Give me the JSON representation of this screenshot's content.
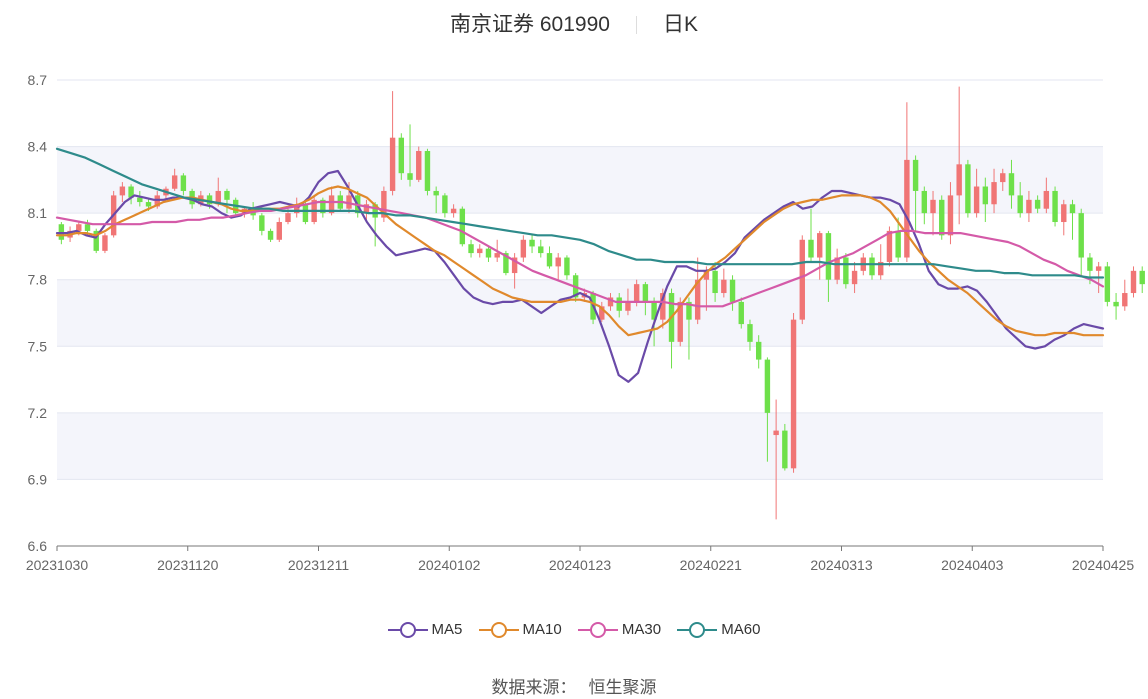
{
  "header": {
    "stock_name": "南京证券 601990",
    "period": "日K"
  },
  "source": {
    "label": "数据来源：",
    "value": "恒生聚源"
  },
  "legend": [
    {
      "name": "MA5",
      "color": "#6a4aa8"
    },
    {
      "name": "MA10",
      "color": "#e0892c"
    },
    {
      "name": "MA30",
      "color": "#d45aa8"
    },
    {
      "name": "MA60",
      "color": "#2e8b8b"
    }
  ],
  "colors": {
    "up": "#f07575",
    "down": "#6ee04a",
    "band": "#f4f5fb",
    "grid": "#e3e6f0",
    "axis": "#777777"
  },
  "chart_data": {
    "type": "candlestick",
    "title": "南京证券 601990 日K",
    "ylim": [
      6.6,
      8.7
    ],
    "yticks": [
      "6.6",
      "6.9",
      "7.2",
      "7.5",
      "7.8",
      "8.1",
      "8.4",
      "8.7"
    ],
    "xtick_labels": [
      "20231030",
      "20231120",
      "20231211",
      "20240102",
      "20240123",
      "20240221",
      "20240313",
      "20240403",
      "20240425"
    ],
    "n_days": 120,
    "candles_ohlc": [
      [
        8.05,
        7.98,
        8.06,
        7.96
      ],
      [
        7.99,
        8.02,
        8.04,
        7.97
      ],
      [
        8.02,
        8.05,
        8.06,
        8.0
      ],
      [
        8.05,
        8.02,
        8.07,
        8.0
      ],
      [
        8.02,
        7.93,
        8.03,
        7.92
      ],
      [
        7.93,
        8.0,
        8.01,
        7.92
      ],
      [
        8.0,
        8.18,
        8.2,
        7.99
      ],
      [
        8.18,
        8.22,
        8.24,
        8.15
      ],
      [
        8.22,
        8.17,
        8.23,
        8.14
      ],
      [
        8.17,
        8.15,
        8.2,
        8.13
      ],
      [
        8.15,
        8.13,
        8.17,
        8.11
      ],
      [
        8.13,
        8.18,
        8.2,
        8.12
      ],
      [
        8.18,
        8.21,
        8.22,
        8.16
      ],
      [
        8.21,
        8.27,
        8.3,
        8.2
      ],
      [
        8.27,
        8.2,
        8.28,
        8.18
      ],
      [
        8.2,
        8.14,
        8.21,
        8.12
      ],
      [
        8.14,
        8.18,
        8.2,
        8.13
      ],
      [
        8.18,
        8.14,
        8.19,
        8.12
      ],
      [
        8.14,
        8.2,
        8.26,
        8.13
      ],
      [
        8.2,
        8.16,
        8.21,
        8.1
      ],
      [
        8.16,
        8.1,
        8.17,
        8.09
      ],
      [
        8.1,
        8.12,
        8.13,
        8.08
      ],
      [
        8.12,
        8.09,
        8.15,
        8.07
      ],
      [
        8.09,
        8.02,
        8.1,
        8.0
      ],
      [
        8.02,
        7.98,
        8.03,
        7.97
      ],
      [
        7.98,
        8.06,
        8.08,
        7.97
      ],
      [
        8.06,
        8.1,
        8.12,
        8.05
      ],
      [
        8.1,
        8.14,
        8.17,
        8.08
      ],
      [
        8.14,
        8.06,
        8.15,
        8.05
      ],
      [
        8.06,
        8.16,
        8.18,
        8.05
      ],
      [
        8.16,
        8.1,
        8.17,
        8.08
      ],
      [
        8.1,
        8.18,
        8.22,
        8.09
      ],
      [
        8.18,
        8.12,
        8.2,
        8.11
      ],
      [
        8.12,
        8.18,
        8.24,
        8.1
      ],
      [
        8.18,
        8.1,
        8.2,
        8.08
      ],
      [
        8.1,
        8.14,
        8.16,
        8.06
      ],
      [
        8.14,
        8.08,
        8.15,
        7.95
      ],
      [
        8.08,
        8.2,
        8.22,
        8.06
      ],
      [
        8.2,
        8.44,
        8.65,
        8.18
      ],
      [
        8.44,
        8.28,
        8.46,
        8.25
      ],
      [
        8.28,
        8.25,
        8.5,
        8.22
      ],
      [
        8.25,
        8.38,
        8.4,
        8.24
      ],
      [
        8.38,
        8.2,
        8.39,
        8.18
      ],
      [
        8.2,
        8.18,
        8.22,
        8.1
      ],
      [
        8.18,
        8.1,
        8.19,
        8.08
      ],
      [
        8.1,
        8.12,
        8.14,
        8.08
      ],
      [
        8.12,
        7.96,
        8.13,
        7.95
      ],
      [
        7.96,
        7.92,
        7.98,
        7.9
      ],
      [
        7.92,
        7.94,
        7.96,
        7.9
      ],
      [
        7.94,
        7.9,
        7.95,
        7.88
      ],
      [
        7.9,
        7.92,
        7.98,
        7.88
      ],
      [
        7.92,
        7.83,
        7.93,
        7.82
      ],
      [
        7.83,
        7.9,
        7.92,
        7.76
      ],
      [
        7.9,
        7.98,
        8.0,
        7.88
      ],
      [
        7.98,
        7.95,
        8.0,
        7.92
      ],
      [
        7.95,
        7.92,
        7.98,
        7.9
      ],
      [
        7.92,
        7.86,
        7.95,
        7.85
      ],
      [
        7.86,
        7.9,
        7.92,
        7.8
      ],
      [
        7.9,
        7.82,
        7.91,
        7.8
      ],
      [
        7.82,
        7.72,
        7.83,
        7.7
      ],
      [
        7.72,
        7.74,
        7.76,
        7.7
      ],
      [
        7.74,
        7.62,
        7.75,
        7.6
      ],
      [
        7.62,
        7.68,
        7.7,
        7.61
      ],
      [
        7.68,
        7.72,
        7.74,
        7.66
      ],
      [
        7.72,
        7.66,
        7.74,
        7.63
      ],
      [
        7.66,
        7.7,
        7.76,
        7.64
      ],
      [
        7.7,
        7.78,
        7.8,
        7.68
      ],
      [
        7.78,
        7.7,
        7.79,
        7.64
      ],
      [
        7.7,
        7.62,
        7.72,
        7.5
      ],
      [
        7.62,
        7.74,
        7.76,
        7.58
      ],
      [
        7.74,
        7.52,
        7.76,
        7.4
      ],
      [
        7.52,
        7.7,
        7.72,
        7.5
      ],
      [
        7.7,
        7.62,
        7.72,
        7.44
      ],
      [
        7.62,
        7.8,
        7.9,
        7.6
      ],
      [
        7.8,
        7.84,
        7.86,
        7.66
      ],
      [
        7.84,
        7.74,
        7.88,
        7.7
      ],
      [
        7.74,
        7.8,
        7.85,
        7.72
      ],
      [
        7.8,
        7.7,
        7.82,
        7.66
      ],
      [
        7.7,
        7.6,
        7.72,
        7.58
      ],
      [
        7.6,
        7.52,
        7.62,
        7.48
      ],
      [
        7.52,
        7.44,
        7.55,
        7.4
      ],
      [
        7.44,
        7.2,
        7.45,
        6.98
      ],
      [
        7.1,
        7.12,
        7.26,
        6.72
      ],
      [
        7.12,
        6.95,
        7.15,
        6.94
      ],
      [
        6.95,
        7.62,
        7.65,
        6.93
      ],
      [
        7.62,
        7.98,
        8.0,
        7.6
      ],
      [
        7.98,
        7.9,
        8.12,
        7.88
      ],
      [
        7.9,
        8.01,
        8.02,
        7.8
      ],
      [
        8.01,
        7.8,
        8.02,
        7.7
      ],
      [
        7.8,
        7.9,
        7.94,
        7.78
      ],
      [
        7.9,
        7.78,
        7.92,
        7.76
      ],
      [
        7.78,
        7.84,
        7.88,
        7.74
      ],
      [
        7.84,
        7.9,
        7.92,
        7.82
      ],
      [
        7.9,
        7.82,
        7.92,
        7.8
      ],
      [
        7.82,
        7.88,
        7.96,
        7.8
      ],
      [
        7.88,
        8.02,
        8.04,
        7.86
      ],
      [
        8.02,
        7.9,
        8.08,
        7.88
      ],
      [
        7.9,
        8.34,
        8.6,
        7.88
      ],
      [
        8.34,
        8.2,
        8.36,
        8.02
      ],
      [
        8.2,
        8.1,
        8.22,
        8.05
      ],
      [
        8.1,
        8.16,
        8.2,
        8.0
      ],
      [
        8.16,
        8.0,
        8.18,
        7.98
      ],
      [
        8.0,
        8.18,
        8.24,
        7.96
      ],
      [
        8.18,
        8.32,
        8.67,
        8.05
      ],
      [
        8.32,
        8.1,
        8.34,
        8.08
      ],
      [
        8.1,
        8.22,
        8.3,
        8.08
      ],
      [
        8.22,
        8.14,
        8.26,
        8.06
      ],
      [
        8.14,
        8.24,
        8.3,
        8.1
      ],
      [
        8.24,
        8.28,
        8.3,
        8.2
      ],
      [
        8.28,
        8.18,
        8.34,
        8.12
      ],
      [
        8.18,
        8.1,
        8.24,
        8.08
      ],
      [
        8.1,
        8.16,
        8.2,
        8.06
      ],
      [
        8.16,
        8.12,
        8.18,
        8.1
      ],
      [
        8.12,
        8.2,
        8.26,
        8.1
      ],
      [
        8.2,
        8.06,
        8.22,
        8.04
      ],
      [
        8.06,
        8.14,
        8.16,
        8.0
      ],
      [
        8.14,
        8.1,
        8.16,
        7.98
      ],
      [
        8.1,
        7.9,
        8.12,
        7.82
      ],
      [
        7.9,
        7.84,
        7.92,
        7.78
      ],
      [
        7.84,
        7.86,
        7.88,
        7.74
      ],
      [
        7.86,
        7.7,
        7.88,
        7.68
      ],
      [
        7.7,
        7.68,
        7.74,
        7.62
      ],
      [
        7.68,
        7.74,
        7.8,
        7.66
      ],
      [
        7.74,
        7.84,
        7.86,
        7.72
      ],
      [
        7.84,
        7.78,
        7.86,
        7.74
      ],
      [
        7.78,
        7.82,
        7.84,
        7.72
      ],
      [
        7.82,
        7.72,
        7.84,
        7.7
      ],
      [
        7.72,
        7.66,
        7.74,
        7.64
      ],
      [
        7.66,
        7.62,
        7.68,
        7.6
      ],
      [
        7.62,
        7.52,
        7.64,
        7.5
      ],
      [
        7.52,
        7.58,
        7.6,
        7.5
      ],
      [
        7.58,
        7.46,
        7.6,
        7.42
      ],
      [
        7.46,
        7.56,
        7.58,
        7.4
      ],
      [
        7.56,
        7.44,
        7.58,
        7.36
      ],
      [
        7.44,
        7.38,
        7.48,
        7.33
      ],
      [
        7.38,
        7.58,
        7.6,
        7.36
      ],
      [
        7.58,
        7.64,
        7.66,
        7.56
      ],
      [
        7.64,
        7.56,
        7.66,
        7.54
      ],
      [
        7.56,
        7.6,
        7.64,
        7.52
      ],
      [
        7.6,
        7.58,
        7.62,
        7.55
      ],
      [
        7.58,
        7.64,
        7.66,
        7.56
      ],
      [
        7.64,
        7.56,
        7.66,
        7.54
      ],
      [
        7.56,
        7.62,
        7.65,
        7.55
      ],
      [
        7.62,
        7.58,
        7.64,
        7.57
      ],
      [
        7.58,
        7.6,
        7.66,
        7.56
      ]
    ],
    "series": [
      {
        "name": "MA5",
        "values": [
          8.01,
          8.01,
          8.02,
          8.0,
          7.99,
          8.05,
          8.1,
          8.15,
          8.18,
          8.17,
          8.16,
          8.16,
          8.17,
          8.17,
          8.16,
          8.14,
          8.13,
          8.1,
          8.08,
          8.09,
          8.12,
          8.13,
          8.14,
          8.15,
          8.14,
          8.13,
          8.17,
          8.24,
          8.28,
          8.29,
          8.22,
          8.14,
          8.06,
          8.0,
          7.95,
          7.91,
          7.92,
          7.93,
          7.94,
          7.93,
          7.88,
          7.82,
          7.76,
          7.72,
          7.7,
          7.69,
          7.7,
          7.7,
          7.71,
          7.68,
          7.65,
          7.68,
          7.71,
          7.72,
          7.74,
          7.72,
          7.62,
          7.5,
          7.37,
          7.34,
          7.38,
          7.52,
          7.65,
          7.77,
          7.86,
          7.86,
          7.84,
          7.84,
          7.85,
          7.88,
          7.92,
          7.99,
          8.03,
          8.07,
          8.1,
          8.13,
          8.15,
          8.12,
          8.13,
          8.17,
          8.2,
          8.2,
          8.19,
          8.18,
          8.17,
          8.17,
          8.16,
          8.14,
          8.06,
          7.96,
          7.84,
          7.78,
          7.76,
          7.76,
          7.77,
          7.75,
          7.7,
          7.64,
          7.58,
          7.54,
          7.5,
          7.49,
          7.5,
          7.53,
          7.55,
          7.58,
          7.6,
          7.59,
          7.58
        ]
      },
      {
        "name": "MA10",
        "values": [
          8.0,
          8.0,
          8.01,
          8.01,
          8.0,
          8.02,
          8.05,
          8.07,
          8.09,
          8.11,
          8.13,
          8.15,
          8.16,
          8.17,
          8.17,
          8.16,
          8.15,
          8.14,
          8.12,
          8.11,
          8.11,
          8.12,
          8.12,
          8.12,
          8.13,
          8.14,
          8.16,
          8.19,
          8.21,
          8.22,
          8.21,
          8.19,
          8.17,
          8.13,
          8.09,
          8.05,
          8.02,
          7.99,
          7.96,
          7.93,
          7.91,
          7.88,
          7.85,
          7.82,
          7.79,
          7.76,
          7.74,
          7.72,
          7.71,
          7.7,
          7.7,
          7.7,
          7.7,
          7.71,
          7.71,
          7.7,
          7.68,
          7.64,
          7.59,
          7.55,
          7.56,
          7.57,
          7.58,
          7.61,
          7.66,
          7.72,
          7.78,
          7.83,
          7.87,
          7.9,
          7.94,
          7.98,
          8.02,
          8.06,
          8.09,
          8.12,
          8.14,
          8.15,
          8.16,
          8.16,
          8.17,
          8.18,
          8.18,
          8.18,
          8.17,
          8.15,
          8.11,
          8.05,
          7.99,
          7.93,
          7.88,
          7.84,
          7.8,
          7.77,
          7.74,
          7.7,
          7.66,
          7.62,
          7.59,
          7.57,
          7.56,
          7.55,
          7.55,
          7.56,
          7.56,
          7.56,
          7.55,
          7.55,
          7.55
        ]
      },
      {
        "name": "MA30",
        "values": [
          8.08,
          8.07,
          8.06,
          8.05,
          8.05,
          8.05,
          8.05,
          8.05,
          8.06,
          8.06,
          8.06,
          8.07,
          8.07,
          8.08,
          8.08,
          8.09,
          8.1,
          8.11,
          8.11,
          8.12,
          8.13,
          8.14,
          8.15,
          8.15,
          8.15,
          8.14,
          8.13,
          8.12,
          8.11,
          8.1,
          8.09,
          8.08,
          8.06,
          8.04,
          8.02,
          7.99,
          7.96,
          7.93,
          7.9,
          7.87,
          7.84,
          7.82,
          7.8,
          7.78,
          7.76,
          7.74,
          7.72,
          7.7,
          7.7,
          7.7,
          7.7,
          7.7,
          7.69,
          7.69,
          7.68,
          7.68,
          7.68,
          7.7,
          7.72,
          7.74,
          7.76,
          7.78,
          7.8,
          7.82,
          7.85,
          7.88,
          7.9,
          7.92,
          7.95,
          7.98,
          8.01,
          8.02,
          8.02,
          8.01,
          8.01,
          8.01,
          8.01,
          8.0,
          7.99,
          7.98,
          7.97,
          7.95,
          7.92,
          7.89,
          7.87,
          7.84,
          7.82,
          7.8,
          7.77
        ]
      },
      {
        "name": "MA60",
        "values": [
          8.39,
          8.37,
          8.35,
          8.32,
          8.29,
          8.26,
          8.23,
          8.21,
          8.19,
          8.17,
          8.16,
          8.15,
          8.14,
          8.13,
          8.12,
          8.12,
          8.11,
          8.11,
          8.11,
          8.11,
          8.11,
          8.11,
          8.1,
          8.1,
          8.09,
          8.09,
          8.08,
          8.07,
          8.06,
          8.05,
          8.04,
          8.03,
          8.02,
          8.01,
          8.0,
          8.0,
          7.99,
          7.98,
          7.96,
          7.93,
          7.91,
          7.89,
          7.89,
          7.88,
          7.88,
          7.88,
          7.87,
          7.87,
          7.87,
          7.87,
          7.87,
          7.87,
          7.87,
          7.88,
          7.88,
          7.87,
          7.87,
          7.87,
          7.87,
          7.87,
          7.87,
          7.87,
          7.87,
          7.86,
          7.85,
          7.84,
          7.84,
          7.83,
          7.83,
          7.82,
          7.82,
          7.82,
          7.82,
          7.81,
          7.81
        ]
      }
    ]
  }
}
